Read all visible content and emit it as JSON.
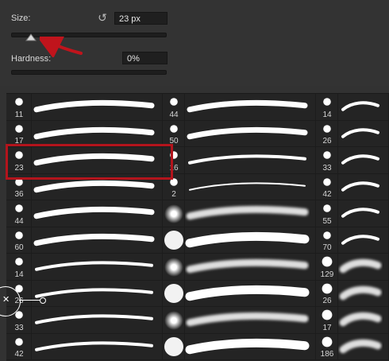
{
  "brush_panel": {
    "size_label": "Size:",
    "size_value": "23 px",
    "size_slider_fraction": 0.12,
    "hardness_label": "Hardness:",
    "hardness_value": "0%",
    "hardness_slider_fraction": 0.0,
    "reset_icon": "reset-arrow-icon"
  },
  "brush_columns": [
    {
      "numbers": [
        "11",
        "17",
        "23",
        "36",
        "44",
        "60",
        "14",
        "26",
        "33",
        "42"
      ]
    },
    {
      "numbers": [
        "44",
        "50",
        "16",
        "2",
        "",
        "",
        "",
        "",
        "",
        ""
      ]
    },
    {
      "numbers": [
        "14",
        "26",
        "33",
        "42",
        "55",
        "70",
        "129",
        "26",
        "17",
        "186"
      ]
    }
  ],
  "selected_brush": "23",
  "colors": {
    "selection": "#b3141c",
    "annotation_arrow": "#c0141c"
  }
}
